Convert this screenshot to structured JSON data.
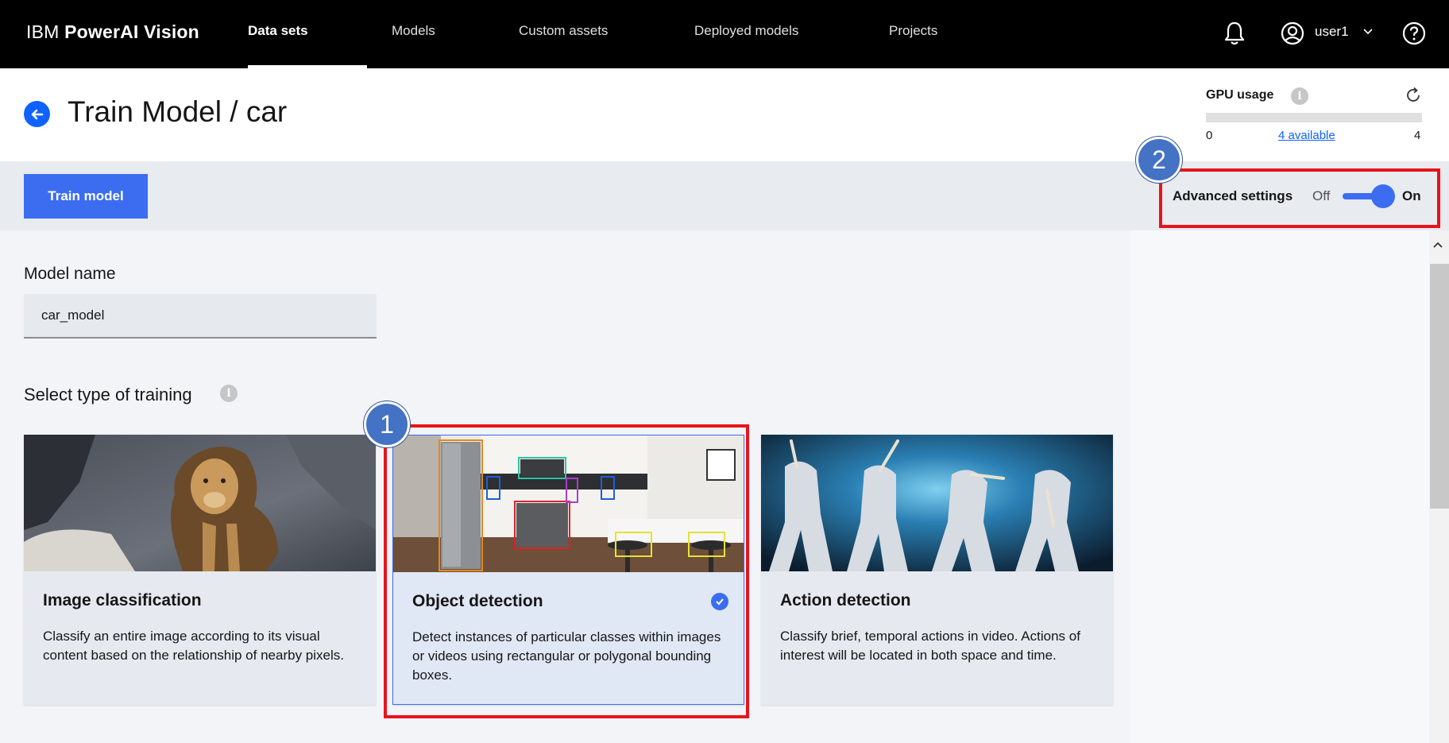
{
  "app": {
    "brand_prefix": "IBM",
    "brand_name": "PowerAI Vision"
  },
  "nav": {
    "items": [
      {
        "label": "Data sets",
        "active": true
      },
      {
        "label": "Models",
        "active": false
      },
      {
        "label": "Custom assets",
        "active": false
      },
      {
        "label": "Deployed models",
        "active": false
      },
      {
        "label": "Projects",
        "active": false
      }
    ],
    "user": "user1",
    "icons": [
      "bell-icon",
      "user-icon",
      "help-icon"
    ]
  },
  "header": {
    "title": "Train Model / car"
  },
  "gpu": {
    "label": "GPU usage",
    "min": "0",
    "available": "4 available",
    "max": "4",
    "used_fraction": 0
  },
  "toolbar": {
    "train_label": "Train model",
    "advanced_label": "Advanced settings",
    "off_label": "Off",
    "on_label": "On",
    "advanced_on": true
  },
  "form": {
    "model_name_label": "Model name",
    "model_name_value": "car_model",
    "training_type_label": "Select type of training"
  },
  "cards": [
    {
      "title": "Image classification",
      "desc": "Classify an entire image according to its visual content based on the relationship of nearby pixels.",
      "selected": false
    },
    {
      "title": "Object detection",
      "desc": "Detect instances of particular classes within images or videos using rectangular or polygonal bounding boxes.",
      "selected": true
    },
    {
      "title": "Action detection",
      "desc": "Classify brief, temporal actions in video. Actions of interest will be located in both space and time.",
      "selected": false
    }
  ],
  "callouts": [
    "1",
    "2"
  ],
  "colors": {
    "accent": "#3c6df0",
    "callout_border": "#e8141c",
    "callout_badge": "#4472c4"
  }
}
